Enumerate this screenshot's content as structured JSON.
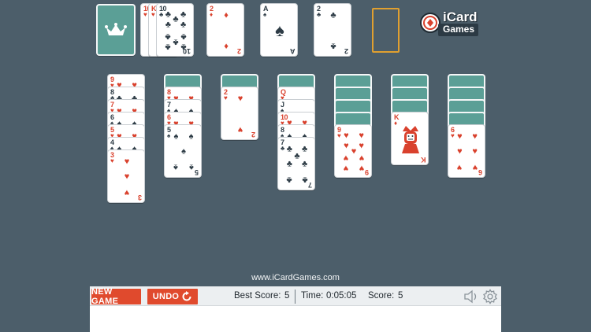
{
  "site_url": "www.iCardGames.com",
  "logo": {
    "line1": "iCard",
    "line2": "Games"
  },
  "colors": {
    "felt": "#4c5e6a",
    "card_back": "#5b9f96",
    "red_suit": "#d9412d",
    "black_suit": "#2e3c46",
    "button": "#e04a2d",
    "empty_slot_border": "#e0a030"
  },
  "toolbar": {
    "new_game_label": "NEW GAME",
    "undo_label": "UNDO",
    "best_score_label": "Best Score:",
    "best_score_value": "5",
    "time_label": "Time:",
    "time_value": "0:05:05",
    "score_label": "Score:",
    "score_value": "5",
    "icons": [
      "sound-icon",
      "settings-icon",
      "undo-arrow-icon"
    ]
  },
  "stock": {
    "face_down": true,
    "emblem": "crown-icon"
  },
  "waste": [
    {
      "rank": "10",
      "suit": "hearts"
    },
    {
      "rank": "K",
      "suit": "hearts"
    },
    {
      "rank": "10",
      "suit": "clubs"
    }
  ],
  "foundations": [
    {
      "rank": "2",
      "suit": "diamonds"
    },
    {
      "rank": "A",
      "suit": "spades"
    },
    {
      "rank": "2",
      "suit": "clubs"
    },
    {
      "rank": "",
      "suit": "",
      "empty": true
    }
  ],
  "tableau": [
    {
      "hidden": 0,
      "cards": [
        {
          "rank": "9",
          "suit": "hearts"
        },
        {
          "rank": "8",
          "suit": "clubs"
        },
        {
          "rank": "7",
          "suit": "hearts"
        },
        {
          "rank": "6",
          "suit": "spades"
        },
        {
          "rank": "5",
          "suit": "hearts"
        },
        {
          "rank": "4",
          "suit": "spades"
        },
        {
          "rank": "3",
          "suit": "hearts"
        }
      ]
    },
    {
      "hidden": 1,
      "cards": [
        {
          "rank": "8",
          "suit": "hearts"
        },
        {
          "rank": "7",
          "suit": "spades"
        },
        {
          "rank": "6",
          "suit": "hearts"
        },
        {
          "rank": "5",
          "suit": "spades"
        }
      ]
    },
    {
      "hidden": 1,
      "cards": [
        {
          "rank": "2",
          "suit": "hearts"
        }
      ]
    },
    {
      "hidden": 1,
      "cards": [
        {
          "rank": "Q",
          "suit": "hearts"
        },
        {
          "rank": "J",
          "suit": "spades"
        },
        {
          "rank": "10",
          "suit": "hearts"
        },
        {
          "rank": "8",
          "suit": "spades"
        },
        {
          "rank": "7",
          "suit": "clubs"
        }
      ]
    },
    {
      "hidden": 4,
      "cards": [
        {
          "rank": "9",
          "suit": "hearts"
        }
      ]
    },
    {
      "hidden": 3,
      "cards": [
        {
          "rank": "K",
          "suit": "diamonds"
        }
      ]
    },
    {
      "hidden": 4,
      "cards": [
        {
          "rank": "6",
          "suit": "hearts"
        }
      ]
    }
  ]
}
